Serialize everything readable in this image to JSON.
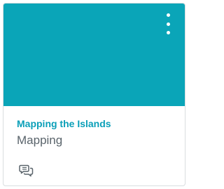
{
  "card": {
    "title": "Mapping the Islands",
    "subtitle": "Mapping",
    "hero_color": "#0aa5b8",
    "title_color": "#0a9fb8",
    "options_icon": "more-vertical-icon",
    "discussions_icon": "discussions-icon"
  }
}
